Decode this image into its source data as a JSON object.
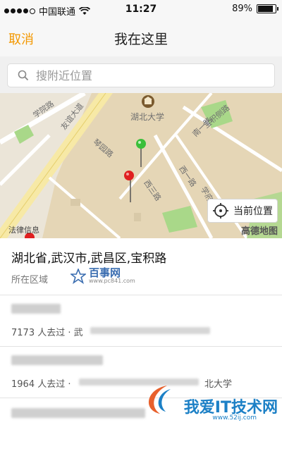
{
  "status_bar": {
    "carrier": "中国联通",
    "time": "11:27",
    "battery": "89%",
    "battery_level": 0.89
  },
  "nav": {
    "cancel": "取消",
    "title": "我在这里"
  },
  "search": {
    "placeholder": "搜附近位置"
  },
  "map": {
    "pois": {
      "university": "湖北大学",
      "road_xueyuan": "学院路",
      "road_youyi": "友谊大道",
      "road_baoji_side": "宝积侧路",
      "road_nan1": "南一路",
      "road_qinyuan": "琴园路",
      "road_xi3": "西三路",
      "road_xi1": "西一路",
      "road_xuefu": "学府路",
      "legal": "法律信息"
    },
    "locate_label": "当前位置",
    "provider": "高德地图"
  },
  "address": {
    "title": "湖北省,武汉市,武昌区,宝积路",
    "subtitle": "所在区域"
  },
  "results": [
    {
      "visits": "7173 人去过 · 武"
    },
    {
      "visits": "1964 人去过 ·",
      "tail": "北大学"
    },
    {
      "visits": ""
    }
  ],
  "watermarks": {
    "top_name": "百事网",
    "top_url": "www.pc841.com",
    "bottom_name": "我爱IT技术网",
    "bottom_url": "www.52ij.com"
  },
  "colors": {
    "accent": "#f39800",
    "pin_green": "#3bbf3b",
    "pin_red": "#e02020",
    "map_bg": "#e9e3d6",
    "park": "#a9d889"
  }
}
